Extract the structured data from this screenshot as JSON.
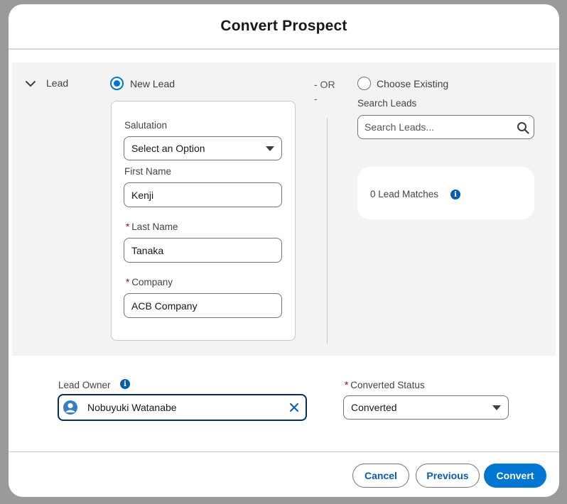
{
  "modal": {
    "title": "Convert Prospect"
  },
  "lead_section": {
    "label": "Lead",
    "new_lead_label": "New Lead",
    "or_label": "- OR -",
    "choose_existing_label": "Choose Existing",
    "new_lead_selected": true
  },
  "new_lead_form": {
    "salutation_label": "Salutation",
    "salutation_value": "Select an Option",
    "first_name_label": "First Name",
    "first_name_value": "Kenji",
    "last_name_label": "Last Name",
    "last_name_value": "Tanaka",
    "company_label": "Company",
    "company_value": "ACB Company",
    "required_marker": "*"
  },
  "existing": {
    "search_label": "Search Leads",
    "search_placeholder": "Search Leads...",
    "matches_text": "0 Lead Matches",
    "info_glyph": "i"
  },
  "bottom": {
    "lead_owner_label": "Lead Owner",
    "lead_owner_value": "Nobuyuki Watanabe",
    "converted_status_label": "Converted Status",
    "converted_status_value": "Converted"
  },
  "footer": {
    "cancel_label": "Cancel",
    "previous_label": "Previous",
    "convert_label": "Convert"
  },
  "colors": {
    "brand": "#0176d3",
    "link_text": "#0b5cab",
    "required": "#ba0517",
    "focus_border": "#032d60"
  },
  "icons": [
    "chevron-down-icon",
    "search-icon",
    "info-icon",
    "user-avatar-icon",
    "close-icon",
    "dropdown-caret-icon"
  ]
}
